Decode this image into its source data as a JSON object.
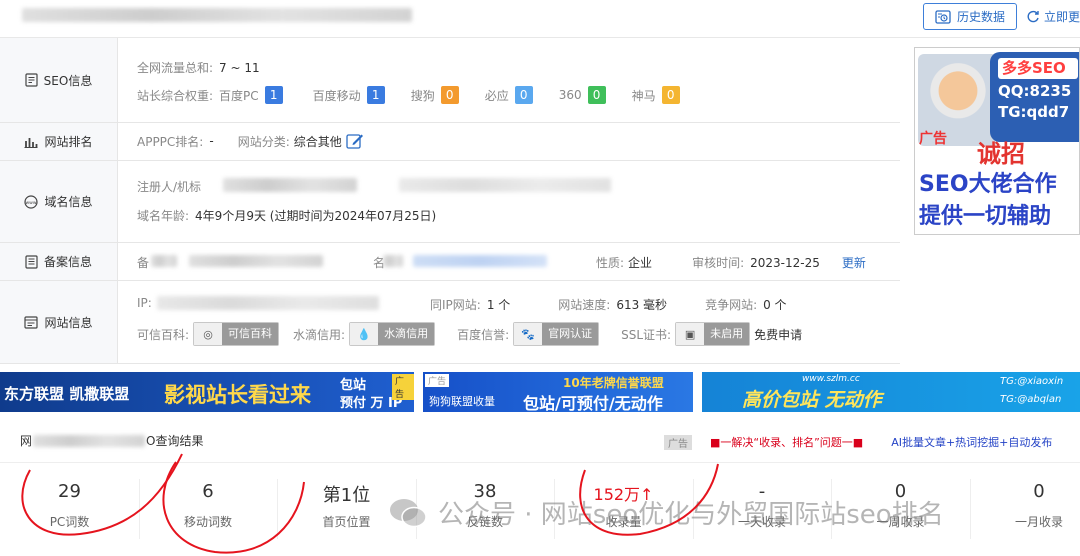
{
  "header": {
    "history_button": "历史数据",
    "update_button": "立即更"
  },
  "seo": {
    "label": "SEO信息",
    "traffic_key": "全网流量总和:",
    "traffic_value": "7 ~ 11",
    "weight_key": "站长综合权重:",
    "engines": [
      {
        "name": "百度PC",
        "value": "1",
        "color": "#3a7be0"
      },
      {
        "name": "百度移动",
        "value": "1",
        "color": "#3a7be0"
      },
      {
        "name": "搜狗",
        "value": "0",
        "color": "#f39a2e"
      },
      {
        "name": "必应",
        "value": "0",
        "color": "#5aa8ef"
      },
      {
        "name": "360",
        "value": "0",
        "color": "#3fbf5a"
      },
      {
        "name": "神马",
        "value": "0",
        "color": "#f4b531"
      }
    ]
  },
  "rank": {
    "label": "网站排名",
    "apppc_key": "APPPC排名:",
    "apppc_value": "-",
    "category_key": "网站分类:",
    "category_value": "综合其他"
  },
  "domain": {
    "label": "域名信息",
    "registrant_key": "注册人/机标",
    "age_key": "域名年龄:",
    "age_value": "4年9个月9天 (过期时间为2024年07月25日)"
  },
  "icp": {
    "label": "备案信息",
    "record_key": "备",
    "name_key": "名",
    "nature_key": "性质:",
    "nature_value": "企业",
    "audit_key": "审核时间:",
    "audit_value": "2023-12-25",
    "refresh_link": "更新"
  },
  "site": {
    "label": "网站信息",
    "ip_key": "IP:",
    "sameip_key": "同IP网站:",
    "sameip_value": "1 个",
    "speed_key": "网站速度:",
    "speed_value": "613 毫秒",
    "competitor_key": "竞争网站:",
    "competitor_value": "0 个",
    "trust_key": "可信百科:",
    "trust_badge": "可信百科",
    "water_key": "水滴信用:",
    "water_badge": "水滴信用",
    "baidu_key": "百度信誉:",
    "baidu_badge": "官网认证",
    "ssl_key": "SSL证书:",
    "ssl_badge": "未启用",
    "ssl_link": "免费申请"
  },
  "side_ad": {
    "bubble_title": "多多SEO",
    "bubble_qq": "QQ:8235",
    "bubble_tg": "TG:qdd7",
    "tag": "广告",
    "line1": "诚招",
    "line2": "SEO大佬合作",
    "line3": "提供一切辅助"
  },
  "banners": {
    "b1_left": "东方联盟 凯撒联盟",
    "b1_main": "影视站长看过来",
    "b1_right_top": "包站",
    "b1_right_bottom": "预付 万 IP",
    "b1_tag": "广告",
    "b2_tag": "广告",
    "b2_top": "10年老牌信誉联盟",
    "b2_left": "狗狗联盟收量",
    "b2_main": "包站/可预付/无动作",
    "b3_url": "www.szlm.cc",
    "b3_main": "高价包站  无动作",
    "b3_tg1": "TG:@xiaoxin",
    "b3_tg2": "TG:@abqlan"
  },
  "query": {
    "title_prefix": "网",
    "title_suffix": "O查询结果",
    "ad_tag": "广告",
    "ad_red": "■一解决“收录、排名”问题一■",
    "ad_blue": "AI批量文章+热词挖掘+自动发布"
  },
  "stats": [
    {
      "value": "29",
      "label": "PC词数"
    },
    {
      "value": "6",
      "label": "移动词数"
    },
    {
      "value": "第1位",
      "label": "首页位置"
    },
    {
      "value": "38",
      "label": "反链数"
    },
    {
      "value": "152万↑",
      "label": "收录量"
    },
    {
      "value": "-",
      "label": "一天收录"
    },
    {
      "value": "0",
      "label": "一周收录"
    },
    {
      "value": "0",
      "label": "一月收录"
    }
  ],
  "watermark": "公众号 · 网站seo优化与外贸国际站seo排名"
}
